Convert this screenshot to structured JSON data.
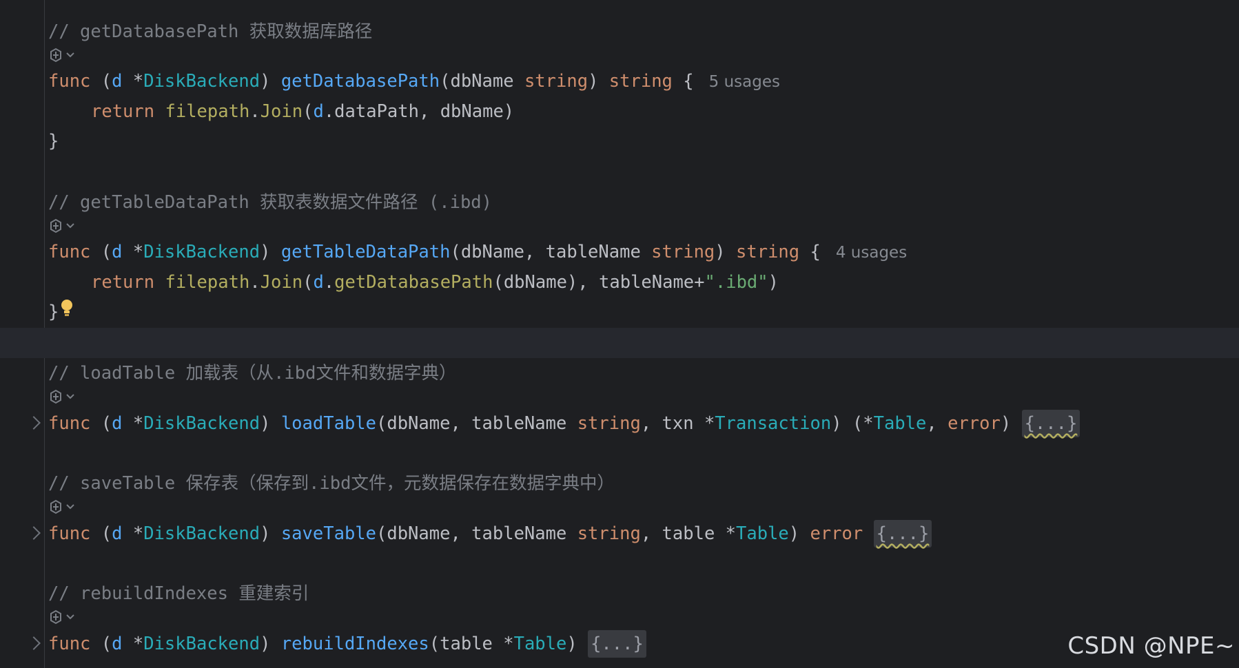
{
  "blocks": [
    {
      "comment": "// getDatabasePath 获取数据库路径",
      "sig": {
        "kw": "func",
        "open": " (",
        "recv": "d",
        "star": " *",
        "recvType": "DiskBackend",
        "close": ") ",
        "name": "getDatabasePath",
        "p1": "(dbName ",
        "t1": "string",
        "p2": ") ",
        "ret": "string",
        "brace": " {",
        "usages": "5 usages"
      },
      "body": {
        "kw": "return",
        "sp": " ",
        "pkg": "filepath",
        "dot": ".",
        "call": "Join",
        "args1": "(",
        "recv": "d",
        "args2": ".dataPath, dbName)"
      },
      "closing": "}"
    },
    {
      "comment": "// getTableDataPath 获取表数据文件路径 (.ibd)",
      "sig": {
        "kw": "func",
        "open": " (",
        "recv": "d",
        "star": " *",
        "recvType": "DiskBackend",
        "close": ") ",
        "name": "getTableDataPath",
        "p1": "(dbName, tableName ",
        "t1": "string",
        "p2": ") ",
        "ret": "string",
        "brace": " {",
        "usages": "4 usages"
      },
      "body": {
        "kw": "return",
        "sp": " ",
        "pkg": "filepath",
        "dot": ".",
        "call": "Join",
        "args1": "(",
        "recv": "d",
        "dot2": ".",
        "call2": "getDatabasePath",
        "args2": "(dbName), tableName+",
        "str": "\".ibd\"",
        "args3": ")"
      },
      "closing": "}"
    },
    {
      "comment": "// loadTable 加载表（从.ibd文件和数据字典）",
      "sig": {
        "kw": "func",
        "open": " (",
        "recv": "d",
        "star": " *",
        "recvType": "DiskBackend",
        "close": ") ",
        "name": "loadTable",
        "p1": "(dbName, tableName ",
        "t1": "string",
        "p2": ", txn *",
        "t2": "Transaction",
        "p3": ") (*",
        "t3": "Table",
        "p4": ", ",
        "t4": "error",
        "p5": ") ",
        "folded": "{...}"
      }
    },
    {
      "comment": "// saveTable 保存表（保存到.ibd文件，元数据保存在数据字典中）",
      "sig": {
        "kw": "func",
        "open": " (",
        "recv": "d",
        "star": " *",
        "recvType": "DiskBackend",
        "close": ") ",
        "name": "saveTable",
        "p1": "(dbName, tableName ",
        "t1": "string",
        "p2": ", table *",
        "t2": "Table",
        "p3": ") ",
        "t3": "error",
        "p4": " ",
        "folded": "{...}"
      }
    },
    {
      "comment": "// rebuildIndexes 重建索引",
      "sig": {
        "kw": "func",
        "open": " (",
        "recv": "d",
        "star": " *",
        "recvType": "DiskBackend",
        "close": ") ",
        "name": "rebuildIndexes",
        "p1": "(table *",
        "t1": "Table",
        "p2": ") ",
        "folded": "{...}"
      }
    }
  ],
  "icons": {
    "ai": "ai-assistant-icon",
    "chevron": "chevron-down-icon",
    "bulb": "lightbulb-icon",
    "fold": "fold-arrow-icon"
  },
  "watermark": "CSDN @NPE~",
  "colors": {
    "bg": "#1e1f22",
    "keyword": "#cf8e6d",
    "function": "#56a8f5",
    "type": "#2aacb8",
    "comment": "#7a7e85",
    "string": "#6aab73"
  }
}
